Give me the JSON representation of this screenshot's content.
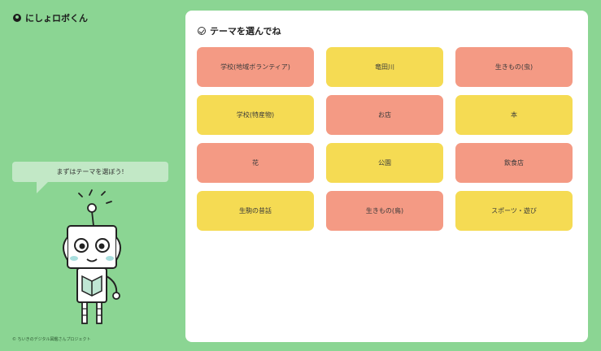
{
  "brand": {
    "name": "にしょロボくん"
  },
  "mascot": {
    "speech": "まずはテーマを選ぼう!"
  },
  "footer": {
    "text": "© ちいきのデジタル図鑑さんプロジェクト"
  },
  "panel": {
    "title": "テーマを選んでね",
    "themes": [
      {
        "label": "学校(地域ボランティア)",
        "color": "#f49a84"
      },
      {
        "label": "竜田川",
        "color": "#f5db53"
      },
      {
        "label": "生きもの(虫)",
        "color": "#f49a84"
      },
      {
        "label": "学校(特産物)",
        "color": "#f5db53"
      },
      {
        "label": "お店",
        "color": "#f49a84"
      },
      {
        "label": "本",
        "color": "#f5db53"
      },
      {
        "label": "花",
        "color": "#f49a84"
      },
      {
        "label": "公園",
        "color": "#f5db53"
      },
      {
        "label": "飲食店",
        "color": "#f49a84"
      },
      {
        "label": "生駒の昔話",
        "color": "#f5db53"
      },
      {
        "label": "生きもの(鳥)",
        "color": "#f49a84"
      },
      {
        "label": "スポーツ・遊び",
        "color": "#f5db53"
      }
    ]
  },
  "colors": {
    "background": "#8bd593",
    "salmon": "#f49a84",
    "yellow": "#f5db53"
  }
}
